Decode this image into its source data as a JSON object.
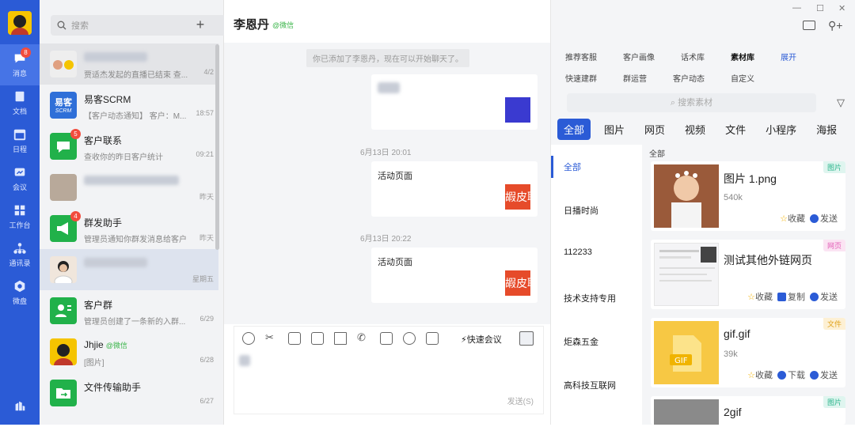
{
  "nav": {
    "items": [
      {
        "label": "消息",
        "badge": "8"
      },
      {
        "label": "文档"
      },
      {
        "label": "日程"
      },
      {
        "label": "会议"
      },
      {
        "label": "工作台"
      },
      {
        "label": "通讯录"
      },
      {
        "label": "微盘"
      }
    ]
  },
  "conv_list": {
    "search_placeholder": "搜索",
    "add_label": "+",
    "items": [
      {
        "name": "",
        "msg": "贾适杰发起的直播已结束 查...",
        "time": "4/2"
      },
      {
        "name": "易客SCRM",
        "msg": "【客户动态通知】 客户：M...",
        "time": "18:57",
        "logo": "易客",
        "logo_sub": "SCRM"
      },
      {
        "name": "客户联系",
        "msg": "查收你的昨日客户统计",
        "time": "09:21",
        "badge": "5"
      },
      {
        "name": "",
        "msg": "",
        "time": "昨天"
      },
      {
        "name": "群发助手",
        "msg": "管理员通知你群发消息给客户",
        "time": "昨天",
        "badge": "4"
      },
      {
        "name": "",
        "msg": "",
        "time": "星期五"
      },
      {
        "name": "客户群",
        "msg": "管理员创建了一条新的入群...",
        "time": "6/29"
      },
      {
        "name": "Jhjie",
        "tag": "@微信",
        "msg": "[图片]",
        "time": "6/28"
      },
      {
        "name": "文件传输助手",
        "msg": "",
        "time": "6/27"
      }
    ]
  },
  "chat": {
    "title": "李恩丹",
    "tag": "@微信",
    "system_msg": "你已添加了李恩丹，现在可以开始聊天了。",
    "timestamps": [
      "6月13日 20:01",
      "6月13日 20:22"
    ],
    "cards": [
      {
        "label": ""
      },
      {
        "label": "活动页面",
        "thumb": "嘏皮联"
      },
      {
        "label": "活动页面",
        "thumb": "嘏皮联"
      }
    ],
    "quick_meeting": "快速会议",
    "send_hint": "发送(S)"
  },
  "panel": {
    "tabs_row1": [
      "推荐客服",
      "客户画像",
      "话术库",
      "素材库",
      "展开"
    ],
    "tabs_row2": [
      "快速建群",
      "群运营",
      "客户动态",
      "自定义"
    ],
    "active_tab": "素材库",
    "search_placeholder": "搜索素材",
    "categories": [
      "全部",
      "图片",
      "网页",
      "视频",
      "文件",
      "小程序",
      "海报"
    ],
    "groups": [
      "全部",
      "日播时尚",
      "112233",
      "技术支持专用",
      "炬森五金",
      "高科技互联网"
    ],
    "section_title": "全部",
    "items": [
      {
        "name": "图片 1.png",
        "size": "540k",
        "tag": "图片",
        "actions": [
          "收藏",
          "发送"
        ]
      },
      {
        "name": "测试其他外链网页",
        "size": "",
        "tag": "网页",
        "actions": [
          "收藏",
          "复制",
          "发送"
        ]
      },
      {
        "name": "gif.gif",
        "size": "39k",
        "tag": "文件",
        "actions": [
          "收藏",
          "下载",
          "发送"
        ],
        "file_label": "GIF"
      },
      {
        "name": "2gif",
        "size": "",
        "tag": "图片",
        "actions": []
      }
    ]
  },
  "colors": {
    "accent": "#2b5bd6",
    "green": "#21b14a",
    "badge": "#f24c3d"
  }
}
